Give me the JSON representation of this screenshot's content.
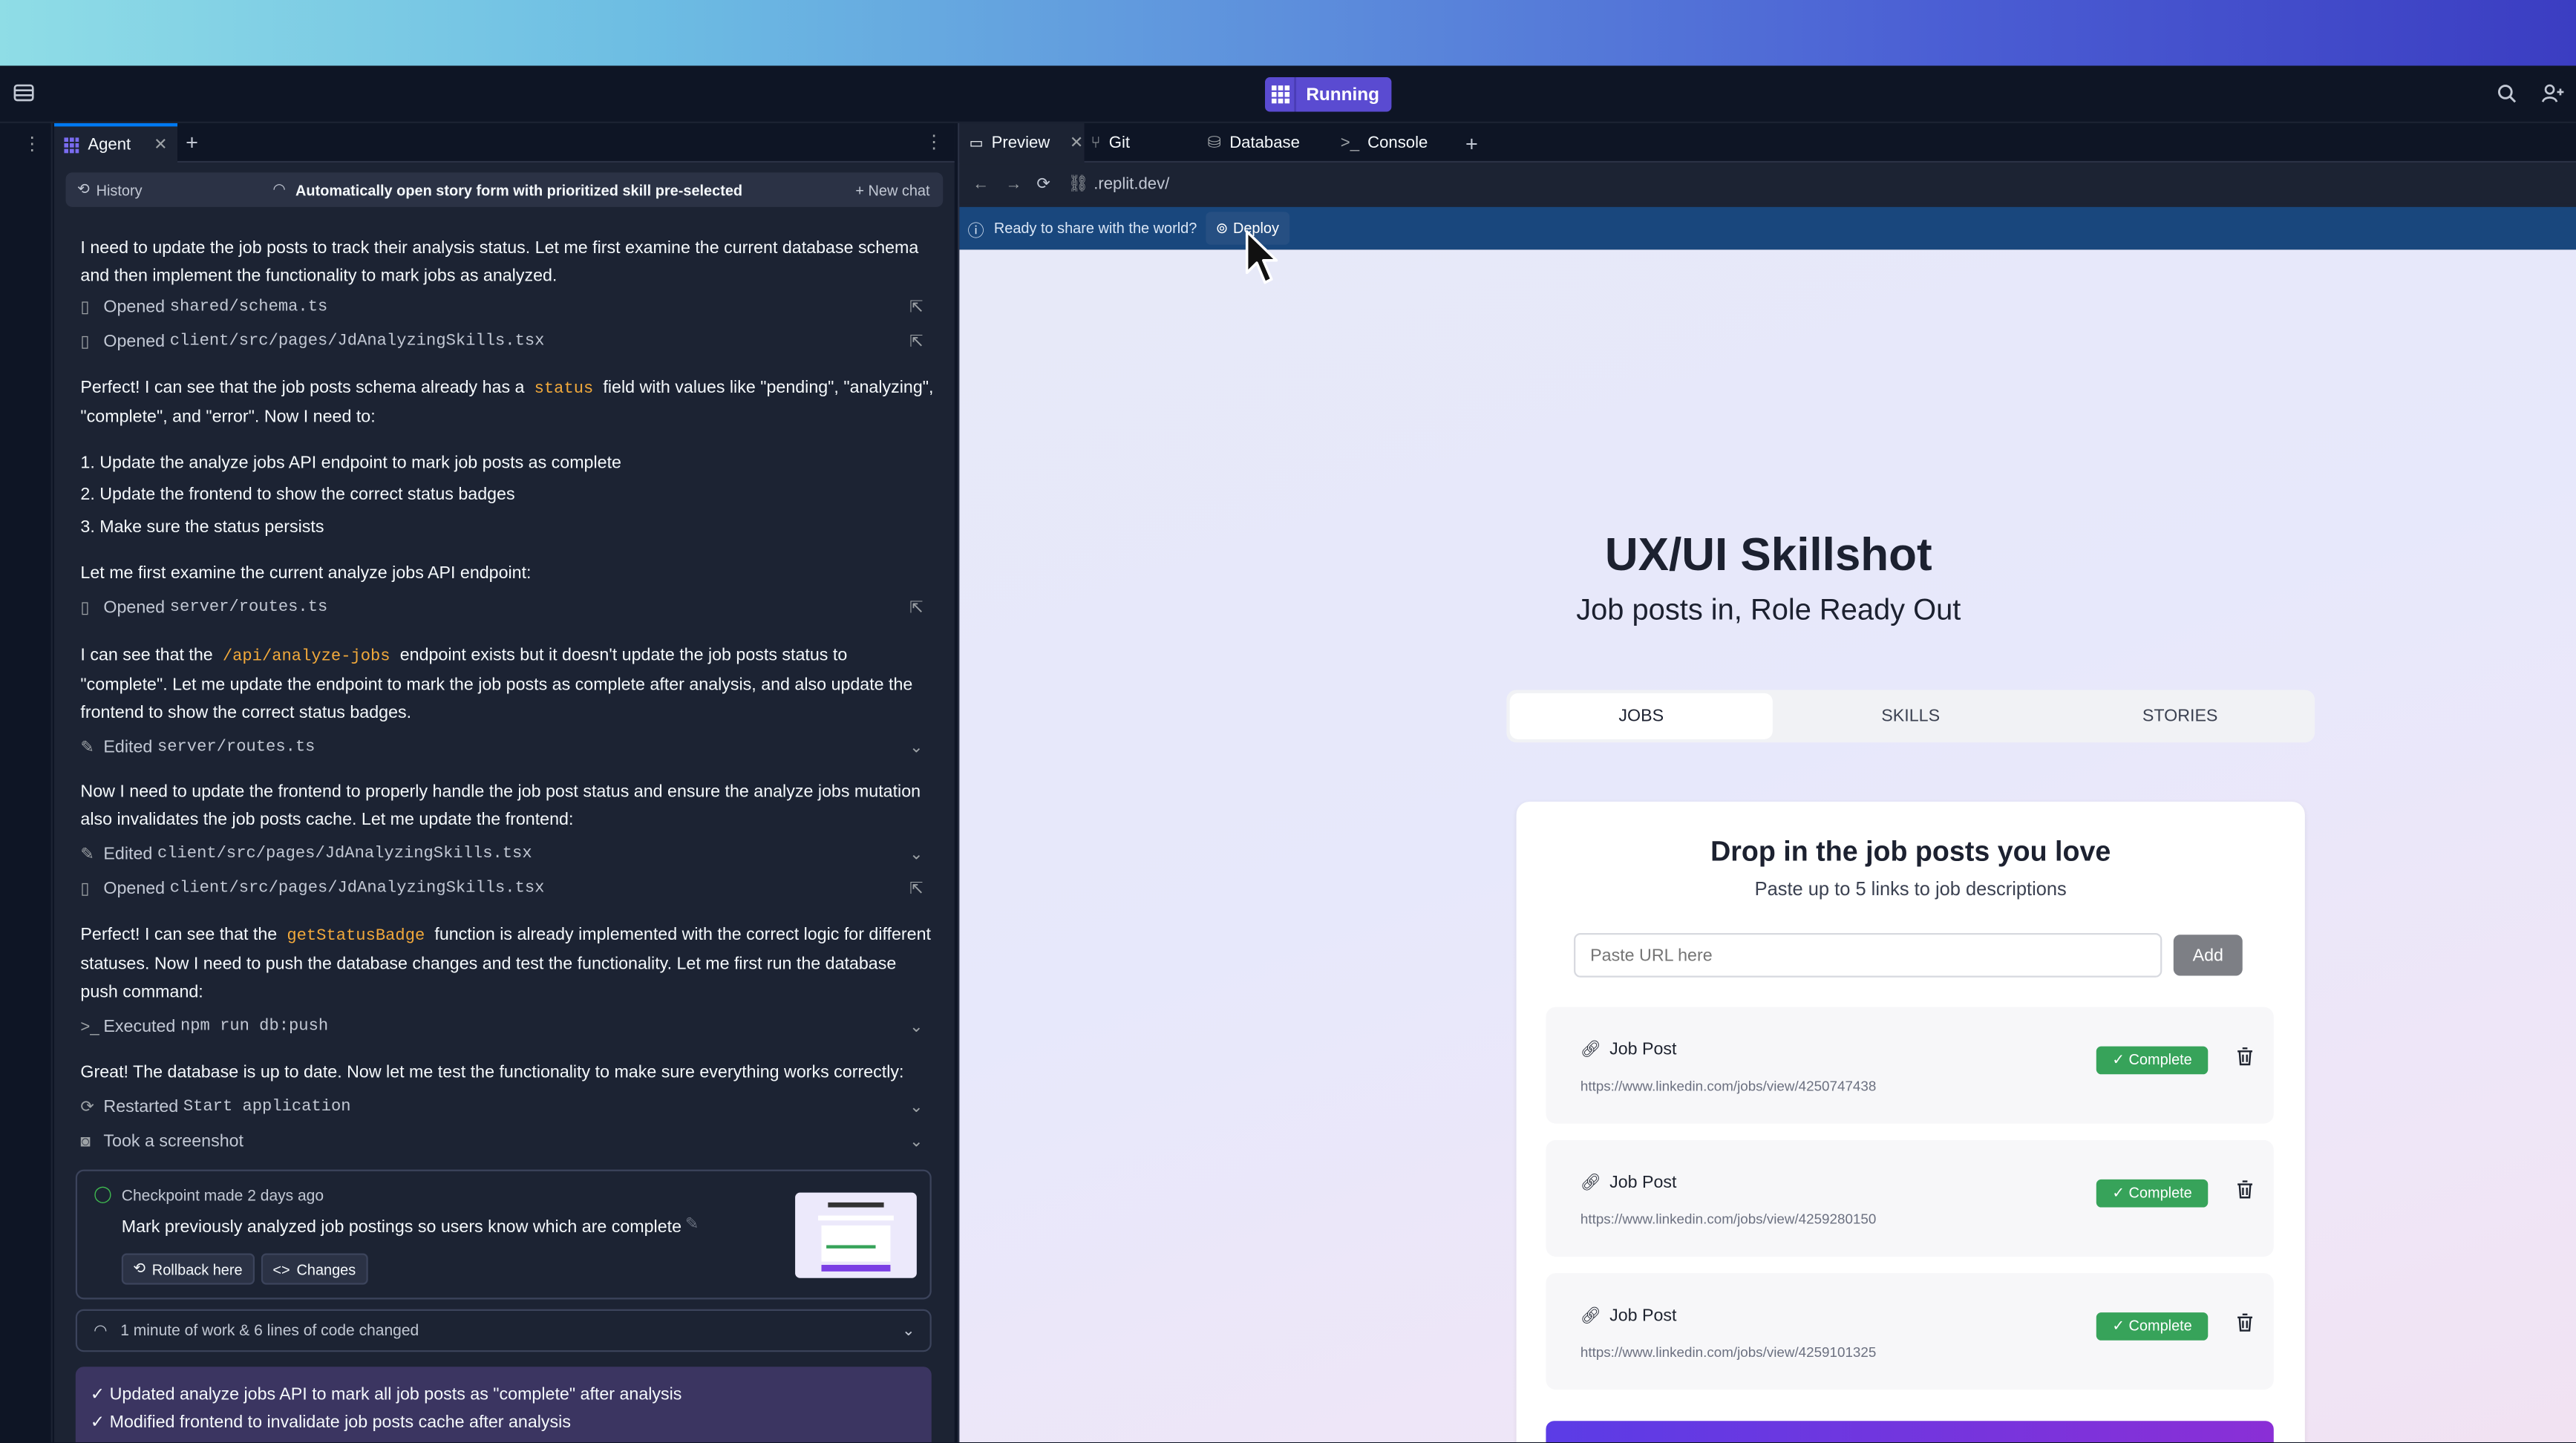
{
  "titlebar": {
    "run_label": "Running"
  },
  "agent": {
    "tab_label": "Agent",
    "history_label": "History",
    "thread_title": "Automatically open story form with prioritized skill pre-selected",
    "new_chat_label": "+ New chat",
    "messages": {
      "m1": "I need to update the job posts to track their analysis status. Let me first examine the current database schema and then implement the functionality to mark jobs as analyzed.",
      "t1_verb": "Opened",
      "t1_file": "shared/schema.ts",
      "t2_verb": "Opened",
      "t2_file": "client/src/pages/JdAnalyzingSkills.tsx",
      "m2a": "Perfect! I can see that the job posts schema already has a",
      "m2code": "status",
      "m2b": "field with values like \"pending\", \"analyzing\", \"complete\", and \"error\". Now I need to:",
      "l1": "1. Update the analyze jobs API endpoint to mark job posts as complete",
      "l2": "2. Update the frontend to show the correct status badges",
      "l3": "3. Make sure the status persists",
      "m3": "Let me first examine the current analyze jobs API endpoint:",
      "t3_verb": "Opened",
      "t3_file": "server/routes.ts",
      "m4a": "I can see that the",
      "m4code": "/api/analyze-jobs",
      "m4b": "endpoint exists but it doesn't update the job posts status to \"complete\". Let me update the endpoint to mark the job posts as complete after analysis, and also update the frontend to show the correct status badges.",
      "t4_verb": "Edited",
      "t4_file": "server/routes.ts",
      "m5": "Now I need to update the frontend to properly handle the job post status and ensure the analyze jobs mutation also invalidates the job posts cache. Let me update the frontend:",
      "t5_verb": "Edited",
      "t5_file": "client/src/pages/JdAnalyzingSkills.tsx",
      "t6_verb": "Opened",
      "t6_file": "client/src/pages/JdAnalyzingSkills.tsx",
      "m6a": "Perfect! I can see that the",
      "m6code": "getStatusBadge",
      "m6b": "function is already implemented with the correct logic for different statuses. Now I need to push the database changes and test the functionality. Let me first run the database push command:",
      "t7_verb": "Executed",
      "t7_file": "npm run db:push",
      "m7": "Great! The database is up to date. Now let me test the functionality to make sure everything works correctly:",
      "t8_verb": "Restarted",
      "t8_file": "Start application",
      "t9_verb": "Took a screenshot"
    },
    "checkpoint": {
      "meta": "Checkpoint made 2 days ago",
      "title": "Mark previously analyzed job postings so users know which are complete",
      "rollback": "Rollback here",
      "changes": "Changes"
    },
    "work_summary": "1 minute of work & 6 lines of code changed",
    "summary_lines": [
      "✓ Updated analyze jobs API to mark all job posts as \"complete\" after analysis",
      "✓ Modified frontend to invalidate job posts cache after analysis"
    ]
  },
  "right": {
    "tabs": {
      "preview": "Preview",
      "git": "Git",
      "database": "Database",
      "console": "Console"
    },
    "url": ".replit.dev/",
    "deploy_prompt": "Ready to share with the world?",
    "deploy_label": "Deploy"
  },
  "app": {
    "title": "UX/UI Skillshot",
    "subtitle": "Job posts in, Role Ready Out",
    "tabs": {
      "jobs": "JOBS",
      "skills": "SKILLS",
      "stories": "STORIES"
    },
    "card_title": "Drop in the job posts you love",
    "card_subtitle": "Paste up to 5 links to job descriptions",
    "url_placeholder": "Paste URL here",
    "add_label": "Add",
    "jobs": [
      {
        "title": "Job Post",
        "url": "https://www.linkedin.com/jobs/view/4250747438",
        "status": "✓ Complete"
      },
      {
        "title": "Job Post",
        "url": "https://www.linkedin.com/jobs/view/4259280150",
        "status": "✓ Complete"
      },
      {
        "title": "Job Post",
        "url": "https://www.linkedin.com/jobs/view/4259101325",
        "status": "✓ Complete"
      }
    ]
  },
  "colors": {
    "accent": "#5a4bd1",
    "complete": "#37a35a",
    "deploy_bar": "#19477d"
  }
}
